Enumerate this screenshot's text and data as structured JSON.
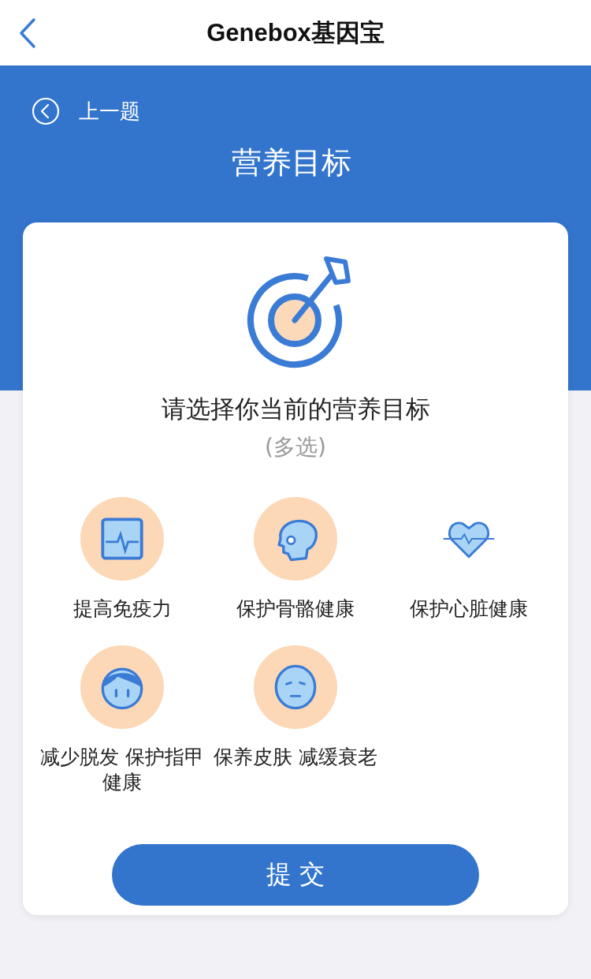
{
  "nav_bar": {
    "title": "Genebox基因宝"
  },
  "header": {
    "previous_label": "上一题",
    "title": "营养目标"
  },
  "card": {
    "question": "请选择你当前的营养目标",
    "hint": "(多选)",
    "options": [
      {
        "kind": "monitor",
        "label": "提高免疫力",
        "selected": true
      },
      {
        "kind": "skull",
        "label": "保护骨骼健康",
        "selected": true
      },
      {
        "kind": "heart",
        "label": "保护心脏健康",
        "selected": false
      },
      {
        "kind": "hair",
        "label": "减少脱发 保护指甲健康",
        "selected": true
      },
      {
        "kind": "mask",
        "label": "保养皮肤 减缓衰老",
        "selected": true
      }
    ],
    "submit_label": "提 交"
  }
}
